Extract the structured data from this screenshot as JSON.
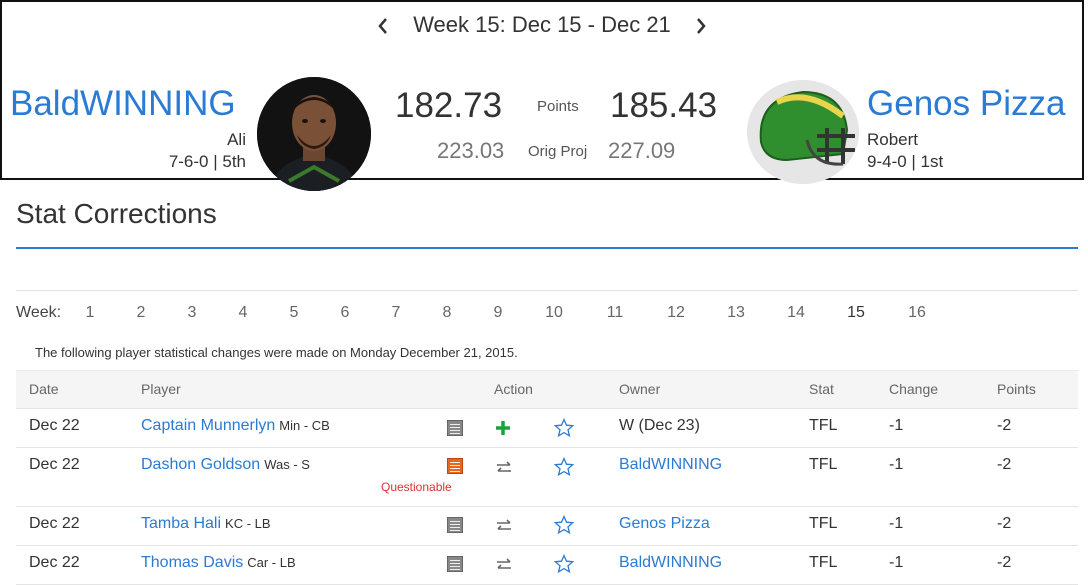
{
  "week_nav": {
    "label": "Week 15: Dec 15 - Dec 21"
  },
  "left_team": {
    "name": "BaldWINNING",
    "owner": "Ali",
    "record": "7-6-0 | 5th",
    "points": "182.73",
    "orig_proj": "223.03"
  },
  "right_team": {
    "name": "Genos Pizza",
    "owner": "Robert",
    "record": "9-4-0 | 1st",
    "points": "185.43",
    "orig_proj": "227.09"
  },
  "labels": {
    "points": "Points",
    "orig_proj": "Orig Proj"
  },
  "section_title": "Stat Corrections",
  "weeks": {
    "label": "Week:",
    "items": [
      "1",
      "2",
      "3",
      "4",
      "5",
      "6",
      "7",
      "8",
      "9",
      "10",
      "11",
      "12",
      "13",
      "14",
      "15",
      "16"
    ],
    "selected": "15"
  },
  "notice": "The following player statistical changes were made on Monday December 21, 2015.",
  "table": {
    "headers": {
      "date": "Date",
      "player": "Player",
      "action": "Action",
      "owner": "Owner",
      "stat": "Stat",
      "change": "Change",
      "points": "Points"
    },
    "rows": [
      {
        "date": "Dec 22",
        "player": "Captain Munnerlyn",
        "pos": "Min - CB",
        "status": "",
        "action": "add-icon",
        "owner": "W (Dec 23)",
        "owner_link": false,
        "stat": "TFL",
        "change": "-1",
        "points": "-2"
      },
      {
        "date": "Dec 22",
        "player": "Dashon Goldson",
        "pos": "Was - S",
        "status": "Questionable",
        "action": "trade-icon",
        "owner": "BaldWINNING",
        "owner_link": true,
        "stat": "TFL",
        "change": "-1",
        "points": "-2"
      },
      {
        "date": "Dec 22",
        "player": "Tamba Hali",
        "pos": "KC - LB",
        "status": "",
        "action": "trade-icon",
        "owner": "Genos Pizza",
        "owner_link": true,
        "stat": "TFL",
        "change": "-1",
        "points": "-2"
      },
      {
        "date": "Dec 22",
        "player": "Thomas Davis",
        "pos": "Car - LB",
        "status": "",
        "action": "trade-icon",
        "owner": "BaldWINNING",
        "owner_link": true,
        "stat": "TFL",
        "change": "-1",
        "points": "-2"
      }
    ]
  },
  "colors": {
    "link": "#2a7bd3",
    "add": "#1aa33b",
    "alert": "#e8651e",
    "questionable": "#e03030"
  }
}
